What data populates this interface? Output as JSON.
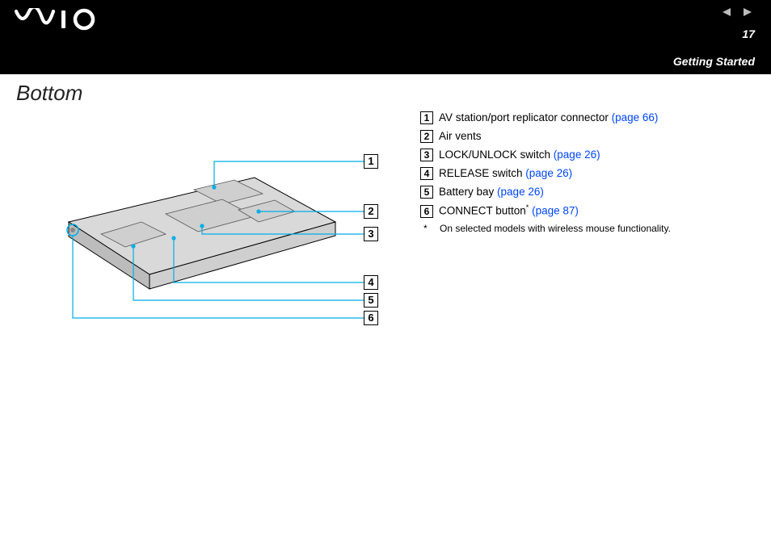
{
  "header": {
    "page_number": "17",
    "section": "Getting Started"
  },
  "title": "Bottom",
  "callouts": [
    "1",
    "2",
    "3",
    "4",
    "5",
    "6"
  ],
  "legend": [
    {
      "n": "1",
      "text": "AV station/port replicator connector ",
      "link": "(page 66)"
    },
    {
      "n": "2",
      "text": "Air vents",
      "link": ""
    },
    {
      "n": "3",
      "text": "LOCK/UNLOCK switch ",
      "link": "(page 26)"
    },
    {
      "n": "4",
      "text": "RELEASE switch ",
      "link": "(page 26)"
    },
    {
      "n": "5",
      "text": "Battery bay ",
      "link": "(page 26)"
    },
    {
      "n": "6",
      "text": "CONNECT button",
      "sup": "*",
      "post": " ",
      "link": "(page 87)"
    }
  ],
  "footnote": {
    "mark": "*",
    "text": "On selected models with wireless mouse functionality."
  }
}
